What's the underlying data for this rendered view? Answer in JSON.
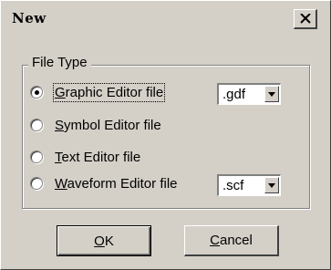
{
  "dialog": {
    "title": "New",
    "close_label": "×"
  },
  "file_type": {
    "legend": "File Type",
    "options": [
      {
        "mnemonic": "G",
        "rest": "raphic Editor file",
        "selected": true
      },
      {
        "mnemonic": "S",
        "rest": "ymbol Editor file",
        "selected": false
      },
      {
        "mnemonic": "T",
        "rest": "ext Editor file",
        "selected": false
      },
      {
        "mnemonic": "W",
        "rest": "aveform Editor file",
        "selected": false
      }
    ],
    "graphic_ext": ".gdf",
    "waveform_ext": ".scf"
  },
  "buttons": {
    "ok_mnemonic": "O",
    "ok_rest": "K",
    "cancel_mnemonic": "C",
    "cancel_rest": "ancel"
  },
  "icons": {
    "close": "close-icon",
    "dropdown": "chevron-down-icon"
  }
}
